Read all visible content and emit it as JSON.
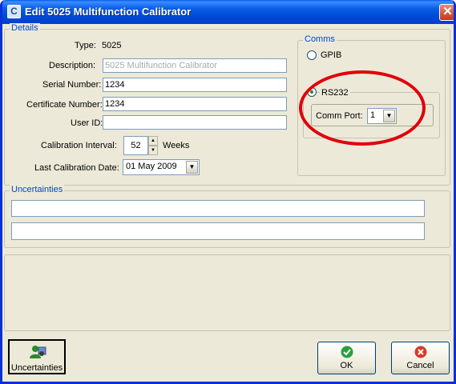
{
  "window": {
    "title": "Edit 5025 Multifunction Calibrator",
    "close_glyph": "✕",
    "app_icon": "calibrator-app-icon"
  },
  "details": {
    "group_label": "Details",
    "type_label": "Type:",
    "type_value": "5025",
    "description_label": "Description:",
    "description_value": "5025 Multifunction Calibrator",
    "serial_label": "Serial Number:",
    "serial_value": "1234",
    "certificate_label": "Certificate Number:",
    "certificate_value": "1234",
    "userid_label": "User ID:",
    "userid_value": "",
    "interval_label": "Calibration Interval:",
    "interval_value": "52",
    "interval_unit": "Weeks",
    "lastcal_label": "Last Calibration Date:",
    "lastcal_value": "01 May 2009"
  },
  "comms": {
    "group_label": "Comms",
    "gpib_label": "GPIB",
    "rs232_label": "RS232",
    "selected": "RS232",
    "comm_port_label": "Comm Port:",
    "comm_port_value": "1"
  },
  "uncertainties": {
    "group_label": "Uncertainties",
    "line1": "",
    "line2": ""
  },
  "buttons": {
    "uncertainties_label": "Uncertainties",
    "ok_label": "OK",
    "cancel_label": "Cancel"
  },
  "annotation": {
    "color": "#e0000a"
  }
}
